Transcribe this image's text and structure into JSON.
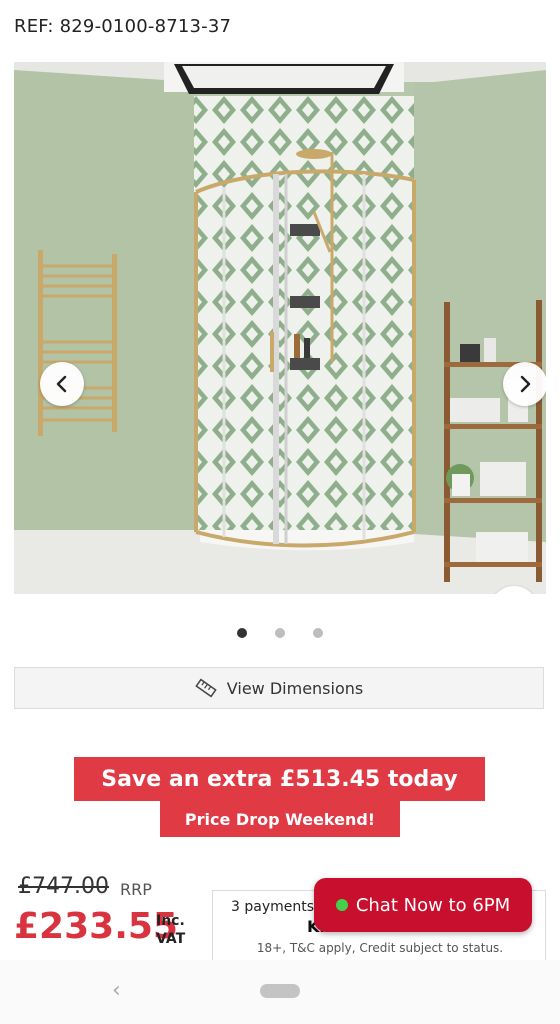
{
  "product": {
    "ref": "REF: 829-0100-8713-37"
  },
  "gallery": {
    "prev_icon": "chevron-left-icon",
    "next_icon": "chevron-right-icon",
    "zoom_icon": "zoom-in-icon",
    "dots_count": 3,
    "active_dot": 1
  },
  "dimensions": {
    "label": "View Dimensions",
    "icon": "ruler-icon"
  },
  "promo": {
    "main": "Save an extra £513.45 today",
    "sub": "Price Drop Weekend!"
  },
  "pricing": {
    "old_price": "£747.00",
    "rrp": "RRP",
    "price": "£233.55",
    "inc": "Inc.",
    "vat": "VAT"
  },
  "payments": {
    "title": "3 payments",
    "provider": "Klarna",
    "terms": "18+, T&C apply, Credit subject to status."
  },
  "chat": {
    "label": "Chat Now to 6PM"
  },
  "colors": {
    "accent_red": "#e03a45",
    "price_red": "#d9333f",
    "chat_red": "#c8102e",
    "online_green": "#43d14b"
  }
}
